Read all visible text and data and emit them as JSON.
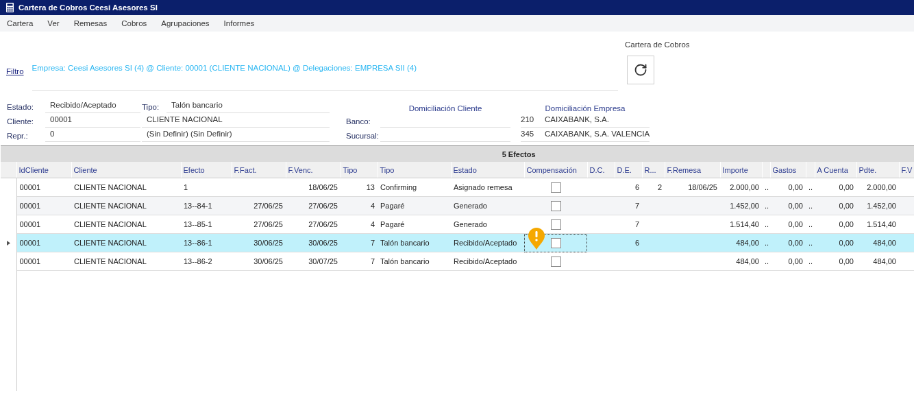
{
  "window": {
    "title": "Cartera de Cobros Ceesi Asesores SI"
  },
  "menu": [
    "Cartera",
    "Ver",
    "Remesas",
    "Cobros",
    "Agrupaciones",
    "Informes"
  ],
  "panel": {
    "title": "Cartera de Cobros"
  },
  "filter": {
    "link": "Filtro",
    "text": "Empresa: Ceesi Asesores SI (4) @ Cliente: 00001 (CLIENTE NACIONAL) @ Delegaciones: EMPRESA SII (4)"
  },
  "summary": {
    "estado": {
      "label": "Estado:",
      "value": "Recibido/Aceptado"
    },
    "tipo": {
      "label": "Tipo:",
      "value": "Talón bancario"
    },
    "cliente": {
      "label": "Cliente:",
      "code": "00001",
      "name": "CLIENTE NACIONAL"
    },
    "repr": {
      "label": "Repr.:",
      "code": "0",
      "name": "(Sin Definir) (Sin Definir)"
    }
  },
  "domiciliacion": {
    "cliente_title": "Domiciliación Cliente",
    "empresa_title": "Domiciliación Empresa",
    "rows": [
      {
        "label": "Banco:",
        "empresa_code": "210",
        "empresa_name": "CAIXABANK, S.A."
      },
      {
        "label": "Sucursal:",
        "empresa_code": "345",
        "empresa_name": "CAIXABANK, S.A. VALENCIA"
      }
    ]
  },
  "table": {
    "group_title": "5 Efectos",
    "columns": [
      {
        "label": "IdCliente",
        "kind": "text"
      },
      {
        "label": "Cliente",
        "kind": "text"
      },
      {
        "label": "Efecto",
        "kind": "text"
      },
      {
        "label": "F.Fact.",
        "kind": "number"
      },
      {
        "label": "F.Venc.",
        "kind": "number"
      },
      {
        "label": "Tipo",
        "kind": "number"
      },
      {
        "label": "Tipo",
        "kind": "text"
      },
      {
        "label": "Estado",
        "kind": "text"
      },
      {
        "label": "Compensación",
        "kind": "check"
      },
      {
        "label": "D.C.",
        "kind": "number"
      },
      {
        "label": "D.E.",
        "kind": "number"
      },
      {
        "label": "R...",
        "kind": "number"
      },
      {
        "label": "F.Remesa",
        "kind": "number"
      },
      {
        "label": "Importe",
        "kind": "number"
      },
      {
        "kind": "text"
      },
      {
        "label": "Gastos",
        "kind": "number"
      },
      {
        "kind": "text"
      },
      {
        "label": "A Cuenta",
        "kind": "number"
      },
      {
        "label": "Pdte.",
        "kind": "number"
      },
      {
        "label": "F.V",
        "kind": "text"
      }
    ],
    "rows": [
      {
        "selected": false,
        "warning": false,
        "cells": [
          "00001",
          "CLIENTE NACIONAL",
          "1",
          null,
          "18/06/25",
          "13",
          "Confirming",
          "Asignado remesa",
          {
            "checked": false
          },
          null,
          "6",
          "2",
          "18/06/25",
          "2.000,00",
          "..",
          "0,00",
          "..",
          "0,00",
          "2.000,00",
          null
        ]
      },
      {
        "selected": false,
        "warning": false,
        "cells": [
          "00001",
          "CLIENTE NACIONAL",
          "13--84-1",
          "27/06/25",
          "27/06/25",
          "4",
          "Pagaré",
          "Generado",
          {
            "checked": false
          },
          null,
          "7",
          null,
          null,
          "1.452,00",
          "..",
          "0,00",
          "..",
          "0,00",
          "1.452,00",
          null
        ]
      },
      {
        "selected": false,
        "warning": false,
        "cells": [
          "00001",
          "CLIENTE NACIONAL",
          "13--85-1",
          "27/06/25",
          "27/06/25",
          "4",
          "Pagaré",
          "Generado",
          {
            "checked": false
          },
          null,
          "7",
          null,
          null,
          "1.514,40",
          "..",
          "0,00",
          "..",
          "0,00",
          "1.514,40",
          null
        ]
      },
      {
        "selected": true,
        "warning": true,
        "cells": [
          "00001",
          "CLIENTE NACIONAL",
          "13--86-1",
          "30/06/25",
          "30/06/25",
          "7",
          "Talón bancario",
          "Recibido/Aceptado",
          {
            "checked": false
          },
          null,
          "6",
          null,
          null,
          "484,00",
          "..",
          "0,00",
          "..",
          "0,00",
          "484,00",
          null
        ]
      },
      {
        "selected": false,
        "warning": false,
        "cells": [
          "00001",
          "CLIENTE NACIONAL",
          "13--86-2",
          "30/06/25",
          "30/07/25",
          "7",
          "Talón bancario",
          "Recibido/Aceptado",
          {
            "checked": false
          },
          null,
          null,
          null,
          null,
          "484,00",
          "..",
          "0,00",
          "..",
          "0,00",
          "484,00",
          null
        ]
      }
    ]
  }
}
